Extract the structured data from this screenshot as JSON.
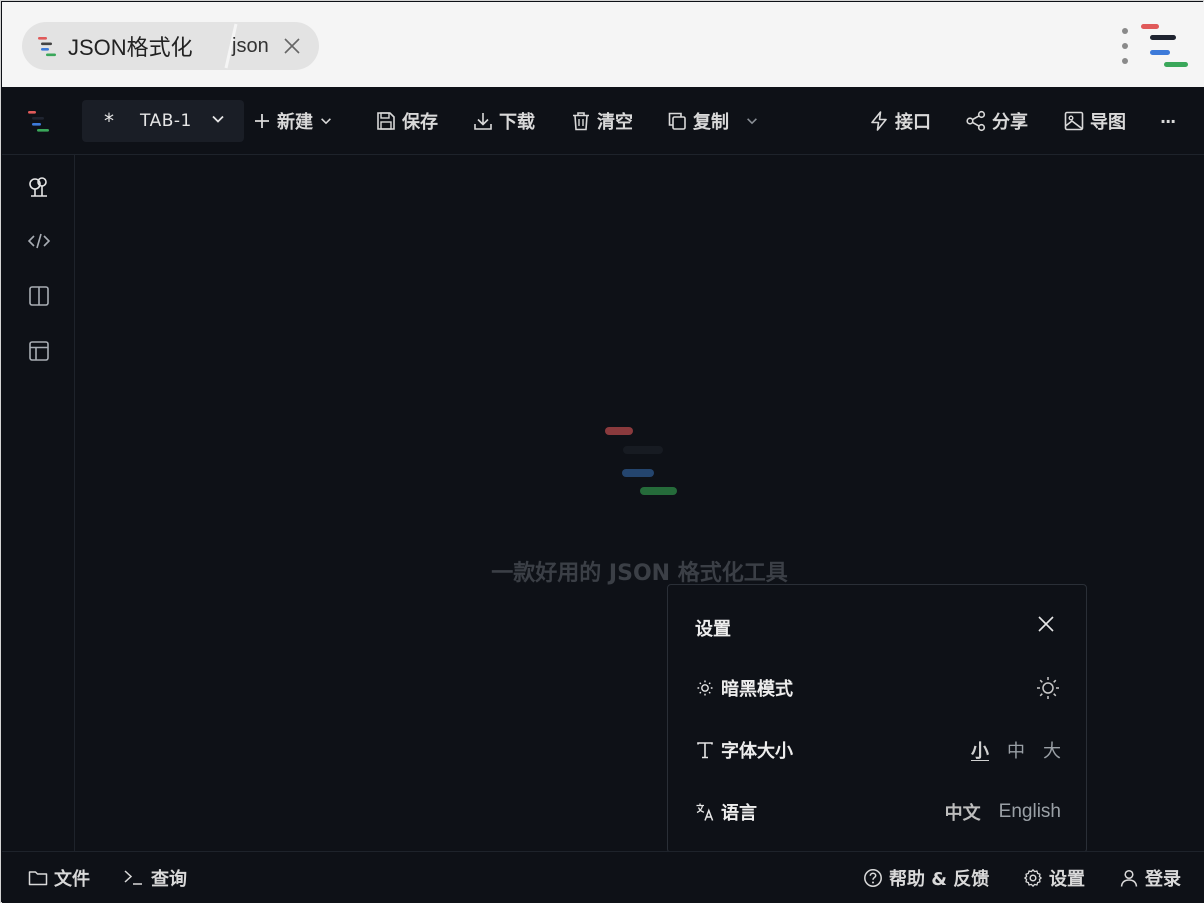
{
  "browser": {
    "tab_title": "JSON格式化",
    "tab_keyword": "json"
  },
  "toolbar": {
    "tab": {
      "star": "*",
      "label": "TAB-1"
    },
    "new_label": "新建",
    "save_label": "保存",
    "download_label": "下载",
    "clear_label": "清空",
    "copy_label": "复制",
    "api_label": "接口",
    "share_label": "分享",
    "export_image_label": "导图",
    "more_label": "···"
  },
  "main": {
    "tagline": "一款好用的 JSON 格式化工具"
  },
  "settings": {
    "title": "设置",
    "dark_mode_label": "暗黑模式",
    "font_size_label": "字体大小",
    "font_sizes": [
      "小",
      "中",
      "大"
    ],
    "font_size_selected": "小",
    "language_label": "语言",
    "languages": [
      "中文",
      "English"
    ],
    "language_selected": "中文"
  },
  "bottombar": {
    "file_label": "文件",
    "query_label": "查询",
    "help_label": "帮助 & 反馈",
    "settings_label": "设置",
    "login_label": "登录"
  },
  "colors": {
    "logo_red": "#e05a5a",
    "logo_dark": "#1f2430",
    "logo_blue": "#3d7ad9",
    "logo_green": "#3aa75a",
    "background": "#0e1117"
  }
}
